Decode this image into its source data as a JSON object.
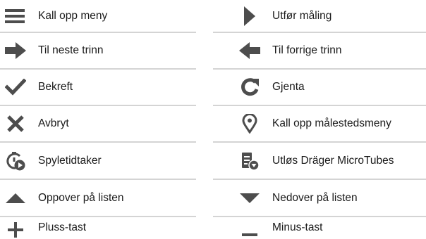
{
  "icon_color": "#4d4d4d",
  "divider_color": "#d4d4d4",
  "rows": [
    {
      "left": {
        "icon": "menu-icon",
        "label": "Kall opp meny"
      },
      "right": {
        "icon": "play-icon",
        "label": "Utfør måling"
      }
    },
    {
      "left": {
        "icon": "arrow-right-icon",
        "label": "Til neste trinn"
      },
      "right": {
        "icon": "arrow-left-icon",
        "label": "Til forrige trinn"
      }
    },
    {
      "left": {
        "icon": "checkmark-icon",
        "label": "Bekreft"
      },
      "right": {
        "icon": "repeat-icon",
        "label": "Gjenta"
      }
    },
    {
      "left": {
        "icon": "cross-icon",
        "label": "Avbryt"
      },
      "right": {
        "icon": "location-pin-icon",
        "label": "Kall opp målestedsmeny"
      }
    },
    {
      "left": {
        "icon": "timer-play-icon",
        "label": "Spyletidtaker"
      },
      "right": {
        "icon": "tube-release-icon",
        "label": "Utløs Dräger MicroTubes"
      }
    },
    {
      "left": {
        "icon": "triangle-up-icon",
        "label": "Oppover på listen"
      },
      "right": {
        "icon": "triangle-down-icon",
        "label": "Nedover på listen"
      }
    },
    {
      "left": {
        "icon": "plus-icon",
        "label": "Pluss-tast"
      },
      "right": {
        "icon": "minus-icon",
        "label": "Minus-tast"
      }
    }
  ]
}
